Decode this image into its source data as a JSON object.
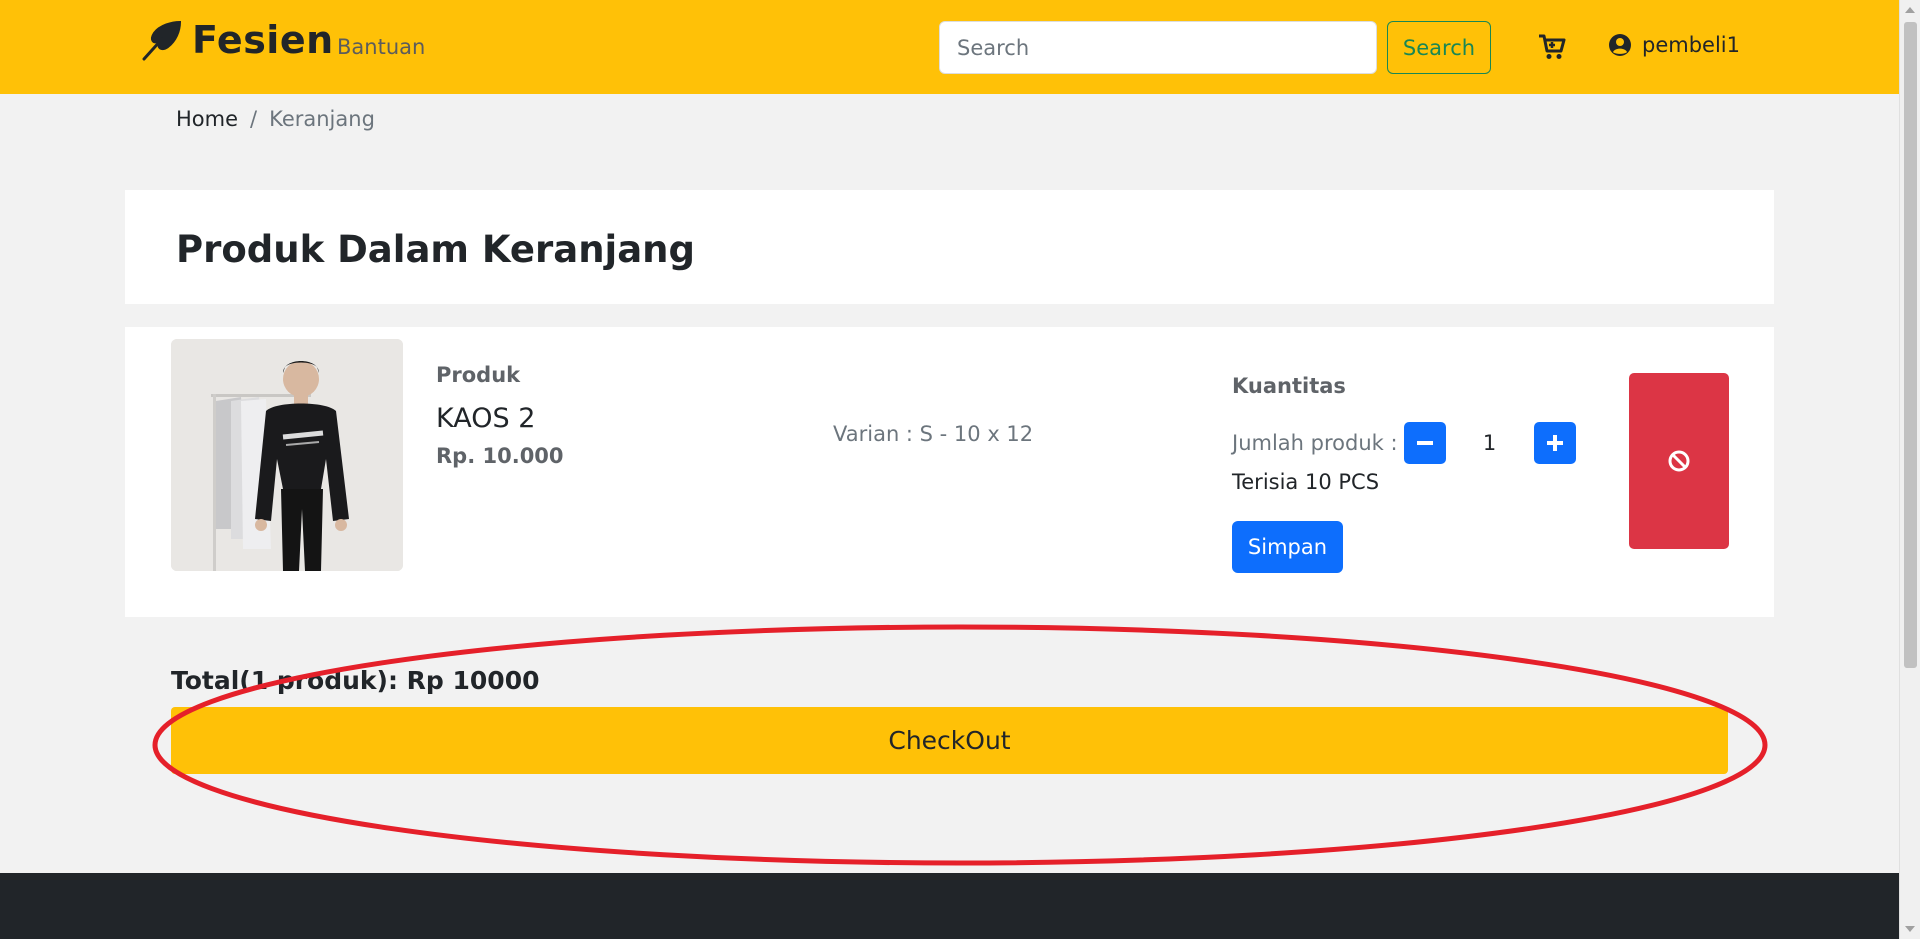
{
  "colors": {
    "brand": "#ffc107",
    "primary": "#0d6efd",
    "danger": "#dc3545",
    "success": "#198754",
    "dark": "#212529"
  },
  "navbar": {
    "brand": "Fesien",
    "brand_icon": "feather-icon",
    "nav_link": "Bantuan",
    "search_placeholder": "Search",
    "search_button": "Search",
    "cart_icon": "cart-icon",
    "user_icon": "user-circle-icon",
    "username": "pembeli1"
  },
  "breadcrumb": {
    "home": "Home",
    "separator": "/",
    "current": "Keranjang"
  },
  "page_title": "Produk Dalam Keranjang",
  "cart_item": {
    "product_label": "Produk",
    "name": "KAOS 2",
    "price": "Rp. 10.000",
    "variant": "Varian : S - 10 x 12",
    "quantity_label": "Kuantitas",
    "quantity_text": "Jumlah produk :",
    "quantity": "1",
    "stock": "Terisia 10 PCS",
    "save_button": "Simpan",
    "delete_icon": "ban-icon"
  },
  "summary": {
    "total": "Total(1 produk): Rp 10000",
    "checkout_button": "CheckOut"
  }
}
